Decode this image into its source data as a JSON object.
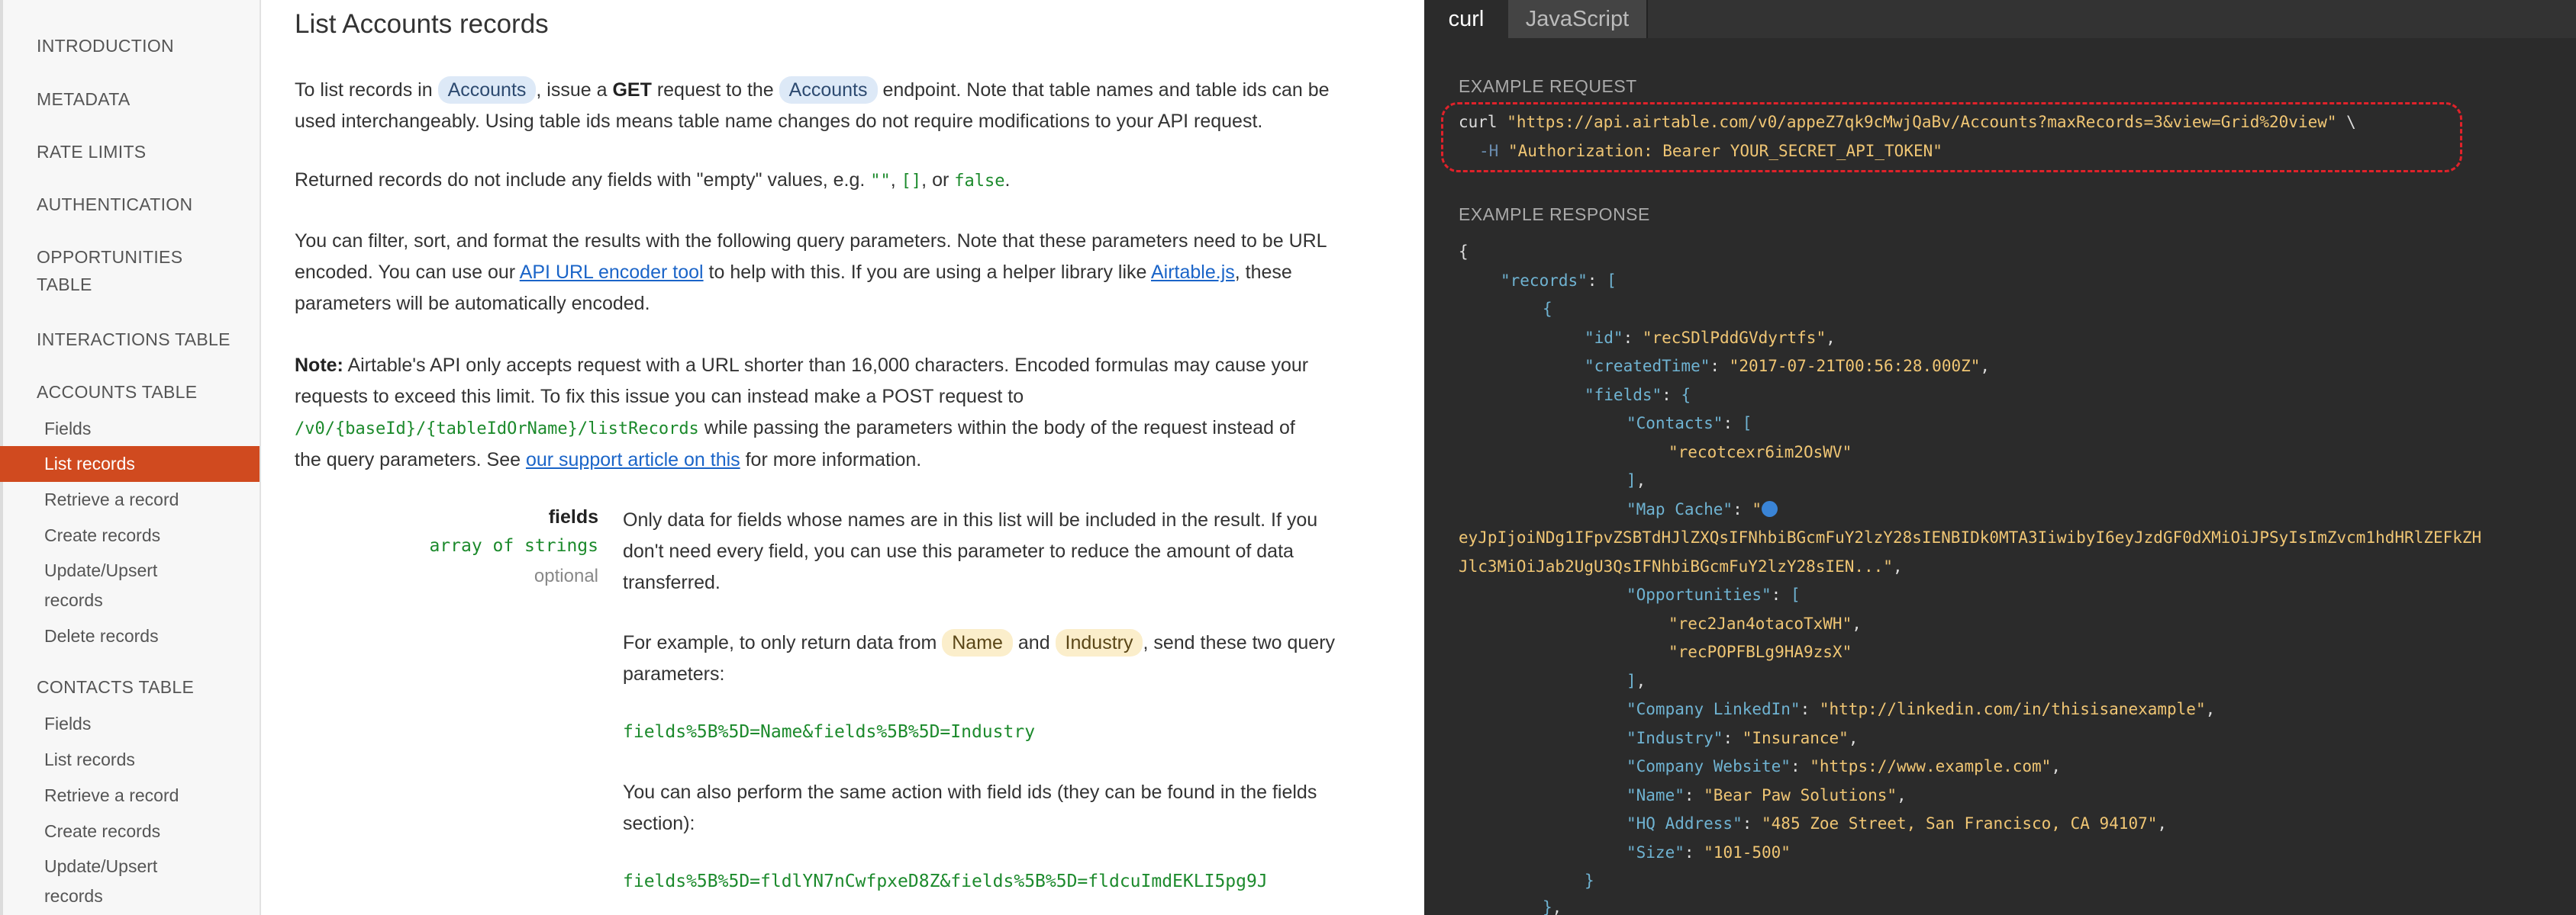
{
  "sidebar": {
    "sections": [
      {
        "label": "INTRODUCTION"
      },
      {
        "label": "METADATA"
      },
      {
        "label": "RATE LIMITS"
      },
      {
        "label": "AUTHENTICATION"
      },
      {
        "label": "OPPORTUNITIES"
      },
      {
        "label": "TABLE"
      },
      {
        "label": "INTERACTIONS TABLE"
      },
      {
        "label": "ACCOUNTS TABLE"
      },
      {
        "label": "CONTACTS TABLE"
      }
    ],
    "accounts_items": [
      "Fields",
      "List records",
      "Retrieve a record",
      "Create records",
      "Update/Upsert",
      "records",
      "Delete records"
    ],
    "contacts_items": [
      "Fields",
      "List records",
      "Retrieve a record",
      "Create records",
      "Update/Upsert",
      "records"
    ],
    "active_item": "List records"
  },
  "main": {
    "title": "List Accounts records",
    "p1": {
      "a": "To list records in ",
      "pill1": "Accounts",
      "b": ", issue a ",
      "get": "GET",
      "c": " request to the ",
      "pill2": "Accounts",
      "d": " endpoint. Note that table names and table ids can be",
      "e": "used interchangeably. Using table ids means table name changes do not require modifications to your API request."
    },
    "p2": {
      "a": "Returned records do not include any fields with \"empty\" values, e.g. ",
      "code1": "\"\"",
      "b": ", ",
      "code2": "[]",
      "c": ", or ",
      "code3": "false",
      "d": "."
    },
    "p3": {
      "a": "You can filter, sort, and format the results with the following query parameters. Note that these parameters need to be URL",
      "b": "encoded. You can use our ",
      "link1": "API URL encoder tool",
      "c": " to help with this. If you are using a helper library like ",
      "link2": "Airtable.js",
      "d": ", these",
      "e": "parameters will be automatically encoded."
    },
    "p4": {
      "note": "Note:",
      "a": " Airtable's API only accepts request with a URL shorter than 16,000 characters. Encoded formulas may cause your",
      "b": "requests to exceed this limit. To fix this issue you can instead make a POST request to",
      "code": "/v0/{baseId}/{tableIdOrName}/listRecords",
      "c": " while passing the parameters within the body of the request instead of",
      "d": "the query parameters. See ",
      "link": "our support article on this",
      "e": " for more information."
    },
    "param": {
      "name": "fields",
      "type": "array of strings",
      "optional": "optional",
      "desc1": "Only data for fields whose names are in this list will be included in the result. If you",
      "desc2": "don't need every field, you can use this parameter to reduce the amount of data",
      "desc3": "transferred.",
      "ex1a": "For example, to only return data from ",
      "pill_name": "Name",
      "ex1b": " and ",
      "pill_industry": "Industry",
      "ex1c": ", send these two query",
      "ex1d": "parameters:",
      "code1": "fields%5B%5D=Name&fields%5B%5D=Industry",
      "ex2a": "You can also perform the same action with field ids (they can be found in the fields",
      "ex2b": "section):",
      "code2": "fields%5B%5D=fldlYN7nCwfpxeD8Z&fields%5B%5D=fldcuImdEKLI5pg9J"
    }
  },
  "code": {
    "tabs": [
      "curl",
      "JavaScript"
    ],
    "active_tab": "curl",
    "request_label": "EXAMPLE REQUEST",
    "request_line1_cmd": "curl ",
    "request_line1_url": "\"https://api.airtable.com/v0/appeZ7qk9cMwjQaBv/Accounts?maxRecords=3&view=Grid%20view\"",
    "request_line1_end": " \\",
    "request_line2_flag": "-H",
    "request_line2_header": "\"Authorization: Bearer YOUR_SECRET_API_TOKEN\"",
    "response_label": "EXAMPLE RESPONSE",
    "response": {
      "records_key": "\"records\"",
      "id_key": "\"id\"",
      "id_val": "\"recSDlPddGVdyrtfs\"",
      "created_key": "\"createdTime\"",
      "created_val": "\"2017-07-21T00:56:28.000Z\"",
      "fields_key": "\"fields\"",
      "contacts_key": "\"Contacts\"",
      "contacts_val": "\"recotcexr6im2OsWV\"",
      "mapcache_key": "\"Map Cache\"",
      "mapcache_open": "\"",
      "mapcache_l1": "eyJpIjoiNDg1IFpvZSBTdHJlZXQsIFNhbiBGcmFuY2lzY28sIENBIDk0MTA3IiwibyI6eyJzdGF0dXMiOiJPSyIsImZvcm1hdHRlZEFkZH",
      "mapcache_l2": "Jlc3MiOiJab2UgU3QsIFNhbiBGcmFuY2lzY28sIEN...\"",
      "opp_key": "\"Opportunities\"",
      "opp_val1": "\"rec2Jan4otacoTxWH\"",
      "opp_val2": "\"recPOPFBLg9HA9zsX\"",
      "linkedin_key": "\"Company LinkedIn\"",
      "linkedin_val": "\"http://linkedin.com/in/thisisanexample\"",
      "industry_key": "\"Industry\"",
      "industry_val": "\"Insurance\"",
      "website_key": "\"Company Website\"",
      "website_val": "\"https://www.example.com\"",
      "name_key": "\"Name\"",
      "name_val": "\"Bear Paw Solutions\"",
      "hq_key": "\"HQ Address\"",
      "hq_val": "\"485 Zoe Street, San Francisco, CA 94107\"",
      "size_key": "\"Size\"",
      "size_val": "\"101-500\""
    }
  }
}
